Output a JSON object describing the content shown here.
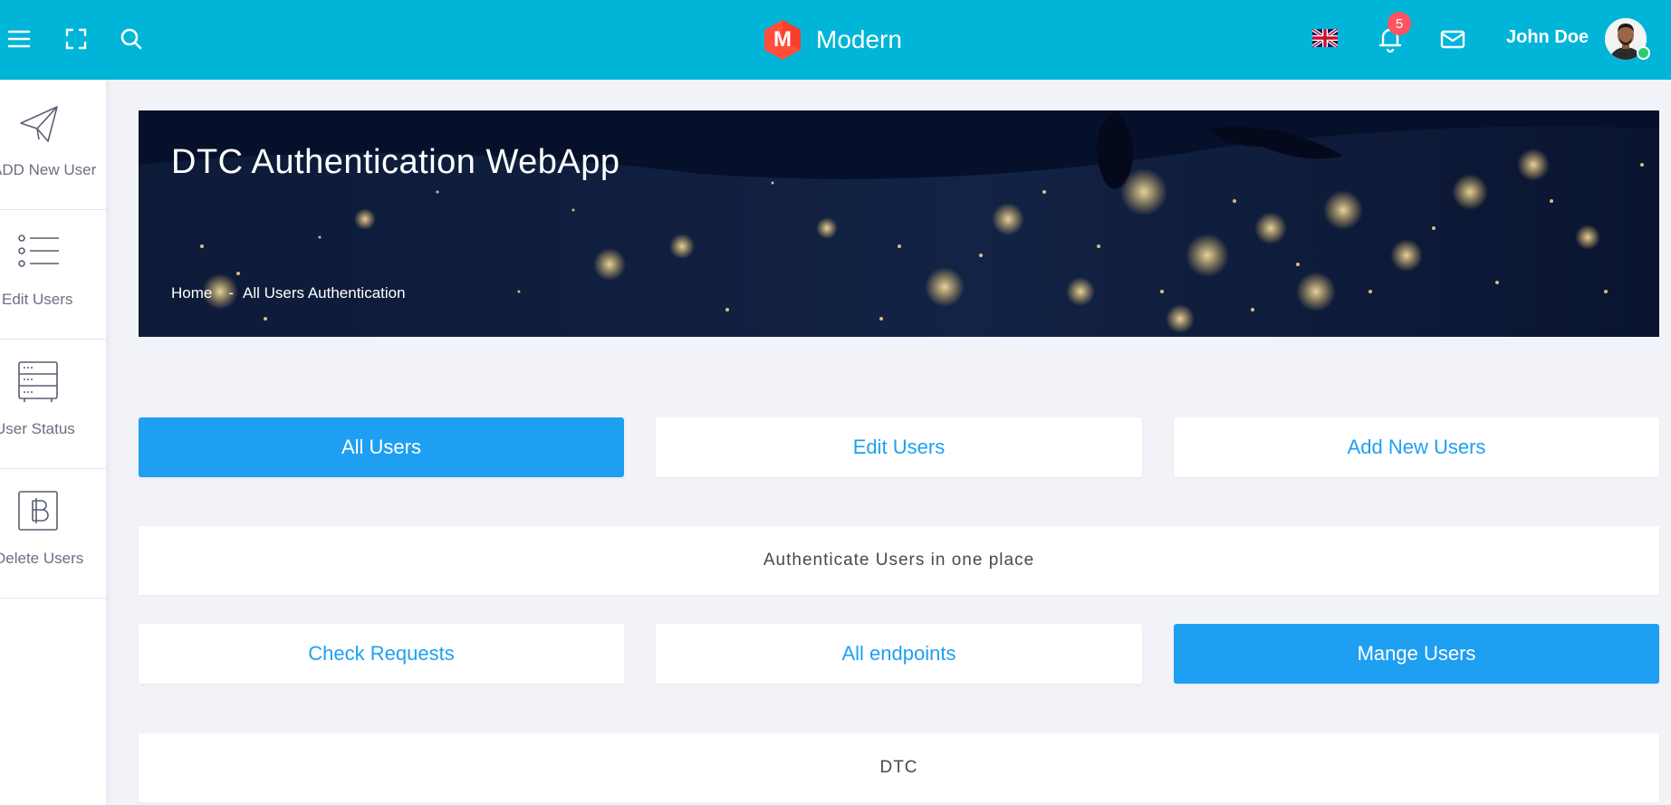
{
  "header": {
    "brand_initial": "M",
    "brand_name": "Modern",
    "notification_count": "5",
    "user_name": "John Doe",
    "accent_color": "#00b5d8",
    "badge_color": "#fe5461"
  },
  "sidebar": {
    "items": [
      {
        "label": "ADD New User",
        "icon": "paper-plane-icon"
      },
      {
        "label": "Edit Users",
        "icon": "list-icon"
      },
      {
        "label": "User Status",
        "icon": "server-icon"
      },
      {
        "label": "Delete Users",
        "icon": "bitcoin-box-icon"
      }
    ]
  },
  "banner": {
    "title": "DTC Authentication WebApp",
    "breadcrumb": [
      "Home",
      "-",
      "All Users Authentication"
    ]
  },
  "tabs": {
    "row1": [
      "All Users",
      "Edit Users",
      "Add New Users"
    ],
    "row2": [
      "Check Requests",
      "All endpoints",
      "Mange Users"
    ]
  },
  "cards": {
    "tagline": "Authenticate Users in one place",
    "footer": "DTC"
  },
  "colors": {
    "primary_button": "#1e9ff2",
    "page_background": "#f2f3f8"
  }
}
